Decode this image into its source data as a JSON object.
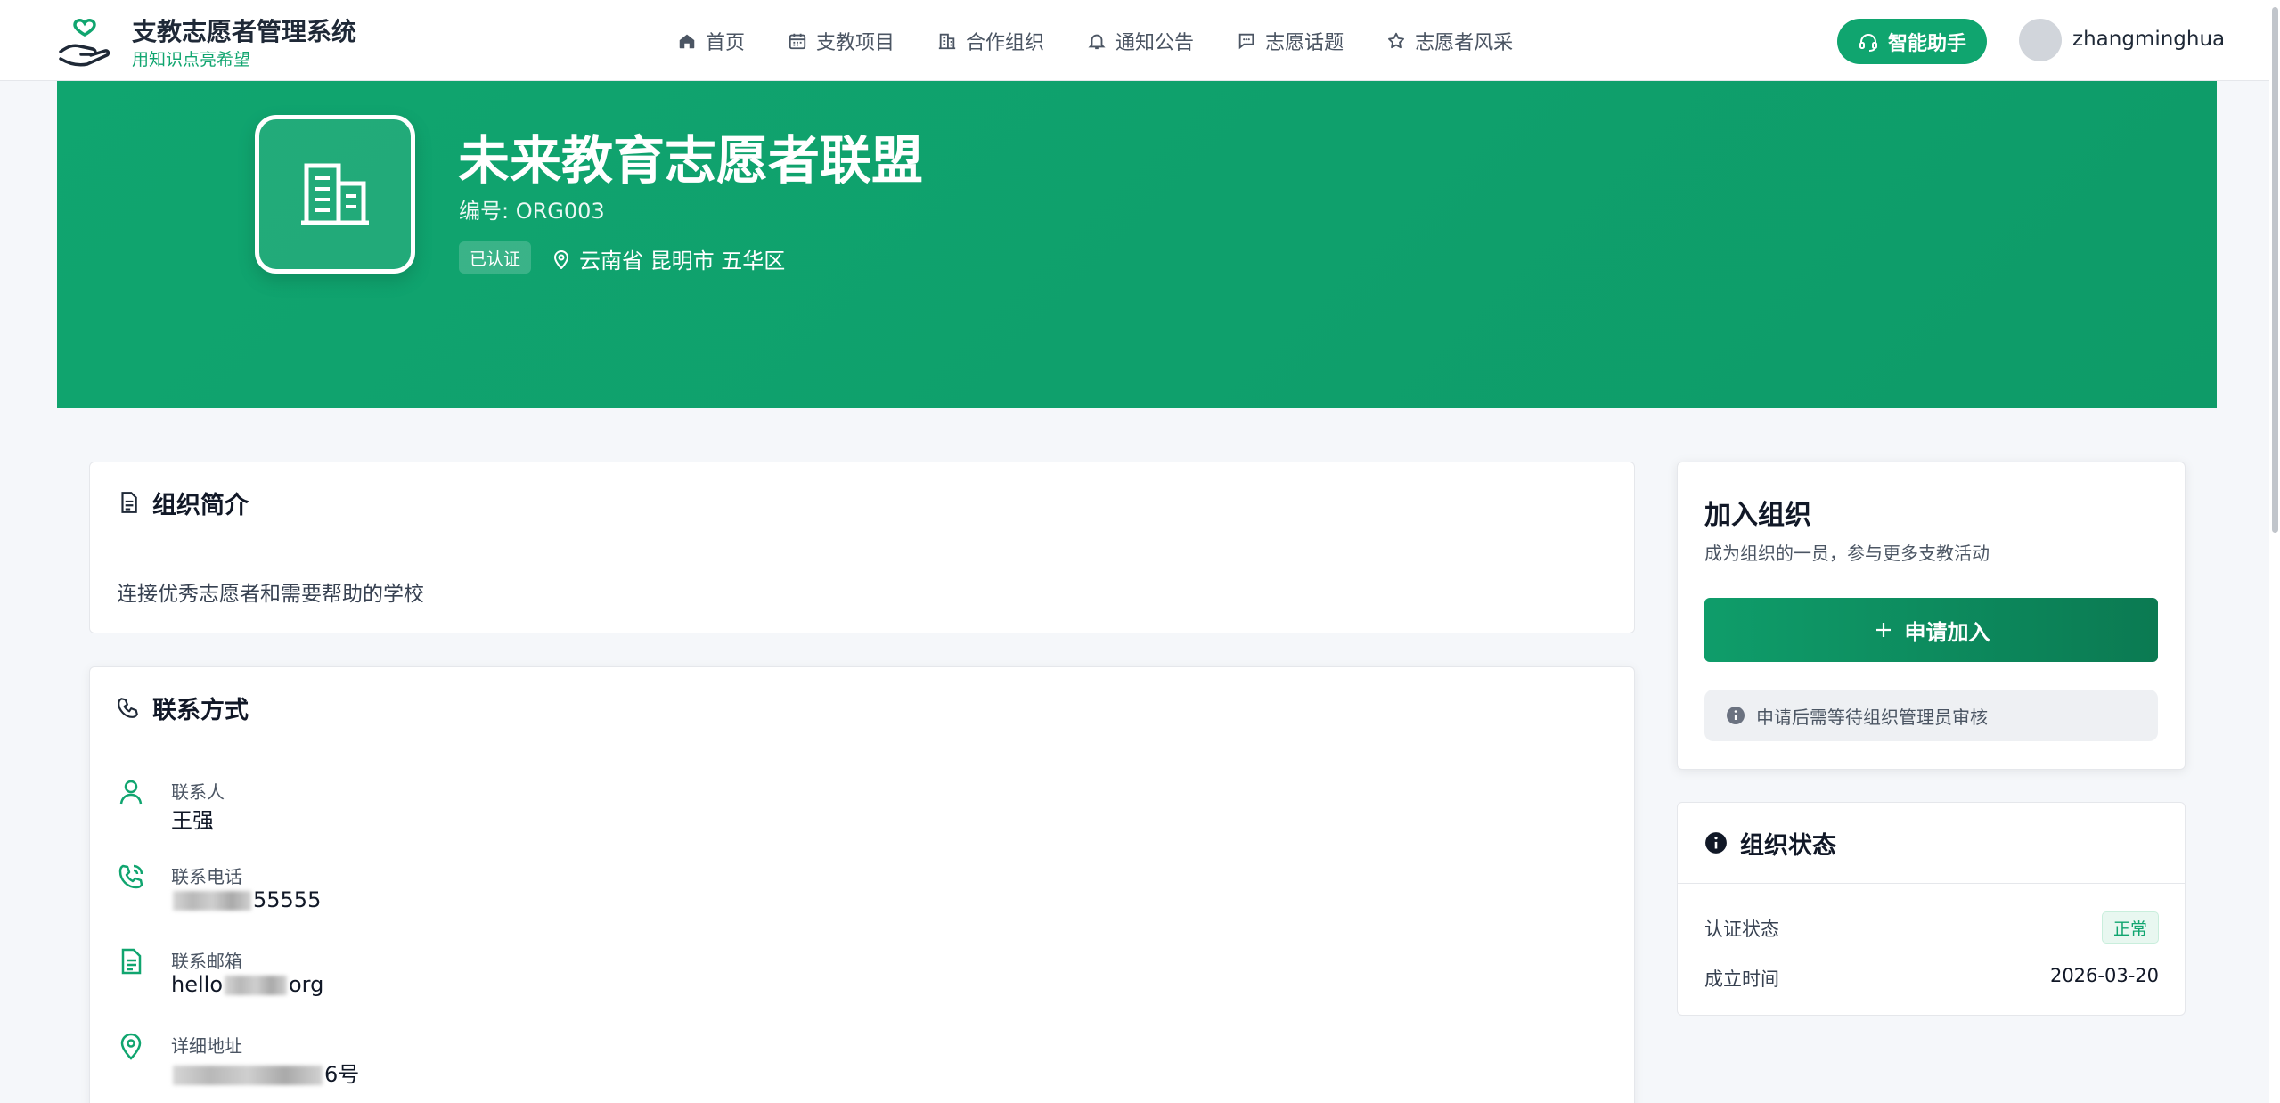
{
  "header": {
    "brand_title": "支教志愿者管理系统",
    "brand_subtitle": "用知识点亮希望",
    "nav": [
      {
        "label": "首页",
        "icon": "home-icon"
      },
      {
        "label": "支教项目",
        "icon": "calendar-icon"
      },
      {
        "label": "合作组织",
        "icon": "building-icon"
      },
      {
        "label": "通知公告",
        "icon": "bell-icon"
      },
      {
        "label": "志愿话题",
        "icon": "chat-icon"
      },
      {
        "label": "志愿者风采",
        "icon": "star-icon"
      }
    ],
    "assistant_label": "智能助手",
    "username": "zhangminghua"
  },
  "hero": {
    "org_name": "未来教育志愿者联盟",
    "org_code": "编号: ORG003",
    "verified_badge": "已认证",
    "location": "云南省 昆明市 五华区"
  },
  "intro": {
    "title": "组织简介",
    "text": "连接优秀志愿者和需要帮助的学校"
  },
  "contact": {
    "title": "联系方式",
    "items": [
      {
        "label": "联系人",
        "value_start": "王强",
        "value_end": ""
      },
      {
        "label": "联系电话",
        "value_start": "",
        "value_end": "55555"
      },
      {
        "label": "联系邮箱",
        "value_start": "hello",
        "value_end": "org"
      },
      {
        "label": "详细地址",
        "value_start": "",
        "value_end": "6号"
      }
    ]
  },
  "join": {
    "title": "加入组织",
    "subtitle": "成为组织的一员，参与更多支教活动",
    "button_label": "申请加入",
    "note": "申请后需等待组织管理员审核"
  },
  "status": {
    "title": "组织状态",
    "rows": [
      {
        "label": "认证状态",
        "value": "正常"
      },
      {
        "label": "成立时间",
        "value": "2026-03-20"
      }
    ]
  },
  "colors": {
    "brand_green": "#10a56f",
    "button_dark_green": "#0b7a52"
  }
}
